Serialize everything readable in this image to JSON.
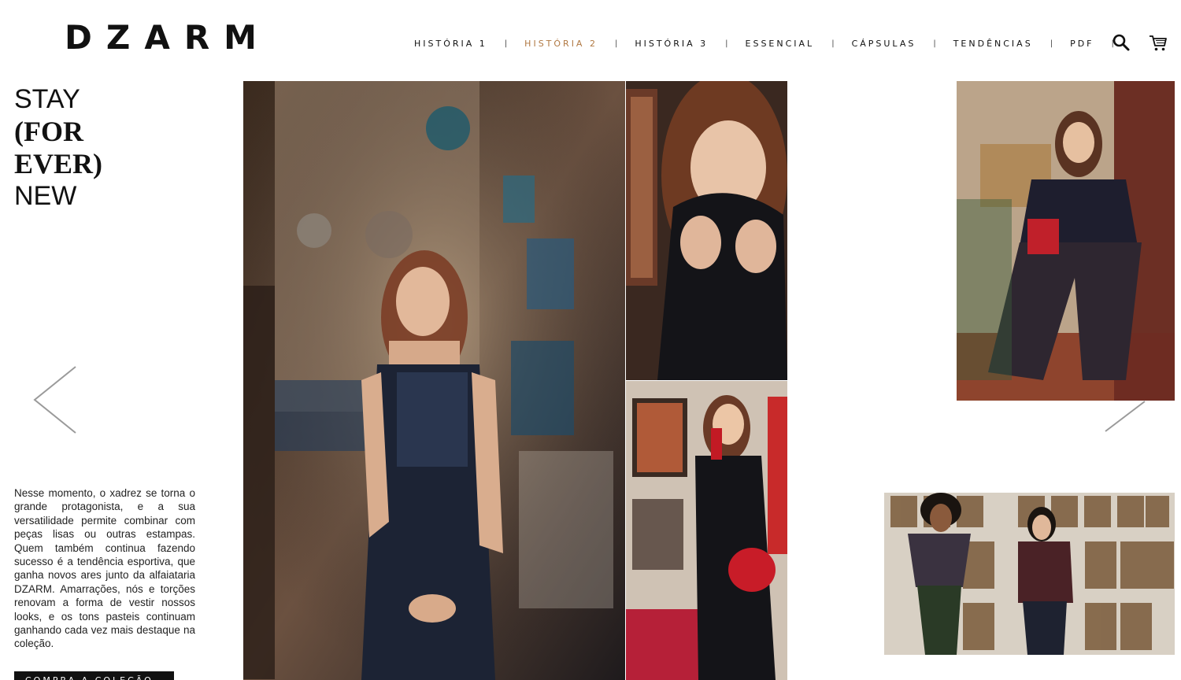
{
  "brand": {
    "logo": "DZARM"
  },
  "nav": {
    "items": [
      {
        "label": "HISTÓRIA 1",
        "active": false
      },
      {
        "label": "HISTÓRIA 2",
        "active": true
      },
      {
        "label": "HISTÓRIA 3",
        "active": false
      },
      {
        "label": "ESSENCIAL",
        "active": false
      },
      {
        "label": "CÁPSULAS",
        "active": false
      },
      {
        "label": "TENDÊNCIAS",
        "active": false
      },
      {
        "label": "PDF",
        "active": false
      }
    ],
    "separator": "|",
    "icons": [
      "search-icon",
      "cart-icon"
    ]
  },
  "headline": {
    "line1": "STAY",
    "line2": "(FOR",
    "line3": "EVER)",
    "line4": "NEW"
  },
  "body_copy": "Nesse momento, o xadrez se torna o grande protagonista, e a sua versatilidade permite combinar com peças lisas ou outras estampas. Quem também continua fazendo sucesso é a tendência esportiva, que ganha novos ares junto da alfaiataria DZARM. Amarrações, nós e torções renovam a forma de vestir nossos looks, e os tons pasteis continuam ganhando cada vez mais destaque na coleção.",
  "cta": {
    "label": "COMPRA A COLEÇÃO"
  },
  "carousel": {
    "prev_icon": "chevron-left-icon",
    "next_icon": "chevron-right-icon"
  },
  "colors": {
    "accent": "#b07842",
    "text": "#111111"
  },
  "photos": [
    "woman-in-plaid-dress-antique-room",
    "woman-black-turtleneck-closeup",
    "woman-with-red-telephone",
    "woman-seated-in-plaid-pants",
    "two-women-frames-wall"
  ]
}
